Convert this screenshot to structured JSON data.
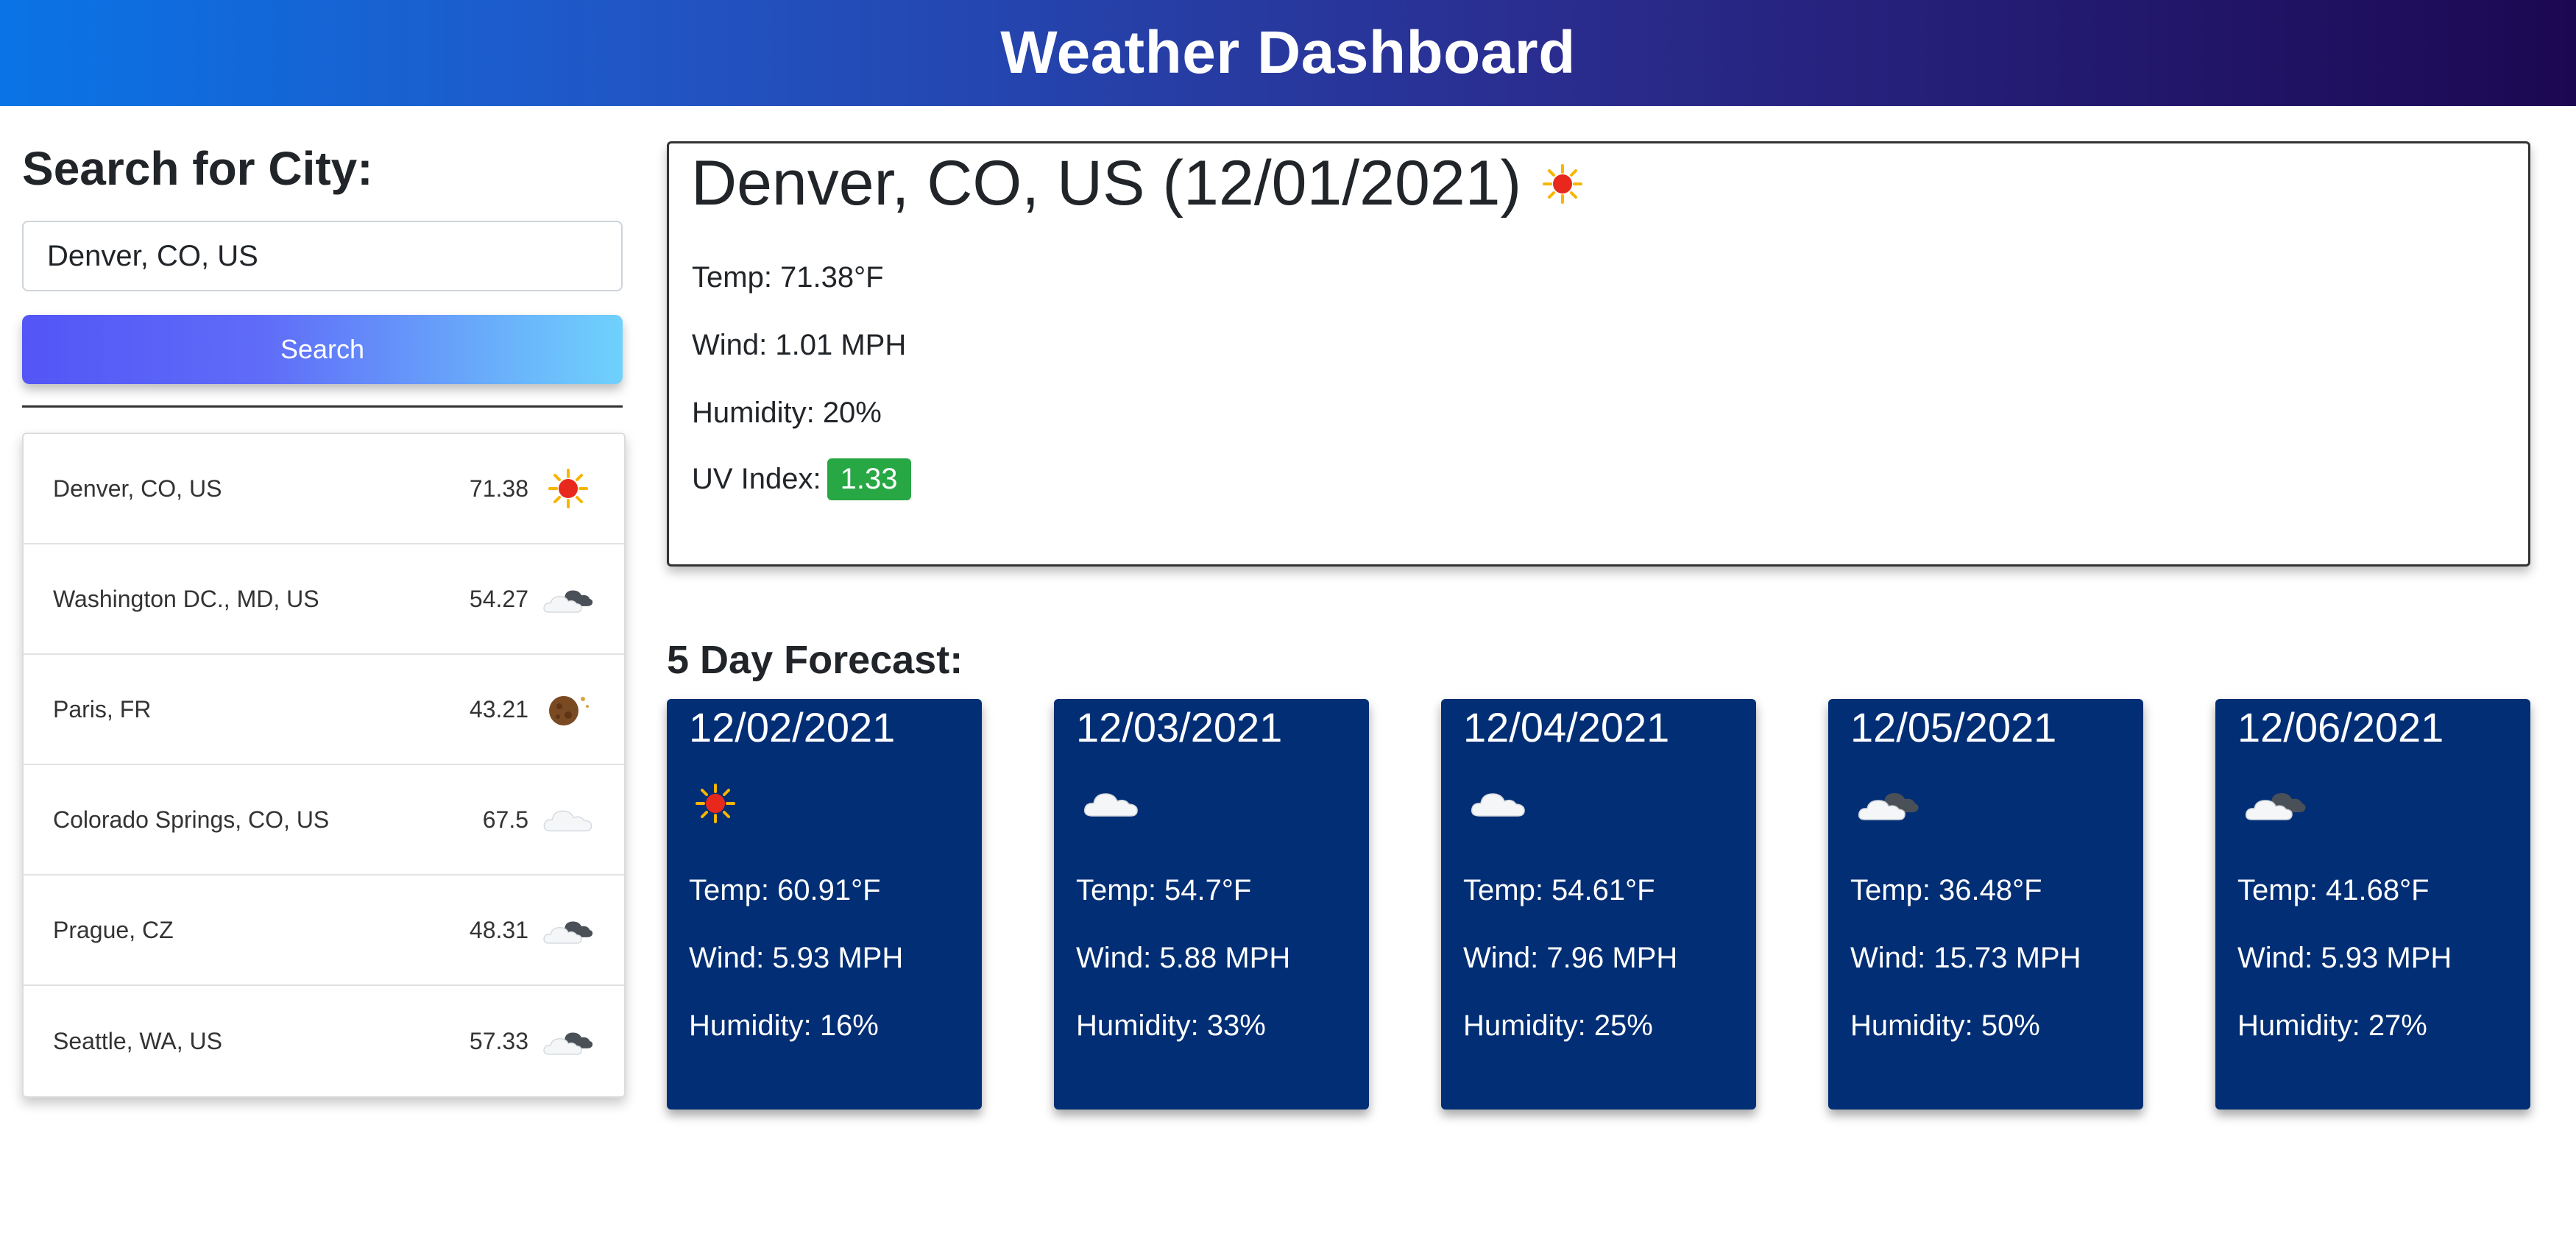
{
  "header": {
    "title": "Weather Dashboard"
  },
  "search": {
    "heading": "Search for City:",
    "input_value": "Denver, CO, US",
    "button_label": "Search"
  },
  "history": [
    {
      "city": "Denver, CO, US",
      "temp": "71.38",
      "icon": "sun-icon"
    },
    {
      "city": "Washington DC., MD, US",
      "temp": "54.27",
      "icon": "clouds-icon"
    },
    {
      "city": "Paris, FR",
      "temp": "43.21",
      "icon": "moon-icon"
    },
    {
      "city": "Colorado Springs, CO, US",
      "temp": "67.5",
      "icon": "cloud-icon"
    },
    {
      "city": "Prague, CZ",
      "temp": "48.31",
      "icon": "clouds-icon"
    },
    {
      "city": "Seattle, WA, US",
      "temp": "57.33",
      "icon": "clouds-icon"
    }
  ],
  "current": {
    "title": "Denver, CO, US (12/01/2021)",
    "icon": "sun-icon",
    "temp": "Temp: 71.38°F",
    "wind": "Wind: 1.01 MPH",
    "humidity": "Humidity: 20%",
    "uv_label": "UV Index:",
    "uv_value": "1.33",
    "uv_color": "#28a745"
  },
  "forecast": {
    "heading": "5 Day Forecast:",
    "days": [
      {
        "date": "12/02/2021",
        "icon": "sun-icon",
        "temp": "Temp: 60.91°F",
        "wind": "Wind: 5.93 MPH",
        "humidity": "Humidity: 16%"
      },
      {
        "date": "12/03/2021",
        "icon": "cloud-icon",
        "temp": "Temp: 54.7°F",
        "wind": "Wind: 5.88 MPH",
        "humidity": "Humidity: 33%"
      },
      {
        "date": "12/04/2021",
        "icon": "cloud-icon",
        "temp": "Temp: 54.61°F",
        "wind": "Wind: 7.96 MPH",
        "humidity": "Humidity: 25%"
      },
      {
        "date": "12/05/2021",
        "icon": "clouds-icon",
        "temp": "Temp: 36.48°F",
        "wind": "Wind: 15.73 MPH",
        "humidity": "Humidity: 50%"
      },
      {
        "date": "12/06/2021",
        "icon": "clouds-icon",
        "temp": "Temp: 41.68°F",
        "wind": "Wind: 5.93 MPH",
        "humidity": "Humidity: 27%"
      }
    ]
  },
  "colors": {
    "header_start": "#0a74e6",
    "header_end": "#1c0852",
    "forecast_card": "#012e74",
    "search_button_start": "#5355f6",
    "search_button_end": "#6fd1fc"
  }
}
